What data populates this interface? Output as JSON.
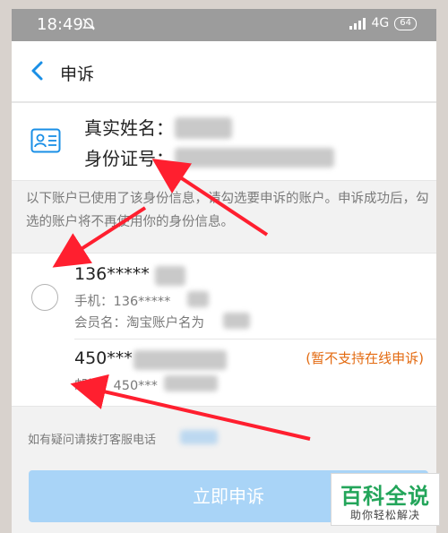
{
  "status_bar": {
    "time": "18:49",
    "network": "4G",
    "battery": "64"
  },
  "nav": {
    "title": "申诉"
  },
  "identity": {
    "name_label": "真实姓名：",
    "id_label": "身份证号："
  },
  "notice": "以下账户已使用了该身份信息，请勾选要申诉的账户。申诉成功后，勾选的账户将不再使用你的身份信息。",
  "accounts": [
    {
      "title": "136*****",
      "phone": "手机：136*****",
      "member": "会员名：淘宝账户名为"
    },
    {
      "title": "450***",
      "email": "邮箱：450***",
      "status": "(暂不支持在线申诉)"
    }
  ],
  "help": "如有疑问请拨打客服电话",
  "submit_label": "立即申诉",
  "watermark": {
    "main": "百科全说",
    "sub": "助你轻松解决"
  },
  "colors": {
    "accent": "#1a8fe6",
    "annotation_arrow": "#ff1f2f",
    "warning": "#e36a10"
  }
}
